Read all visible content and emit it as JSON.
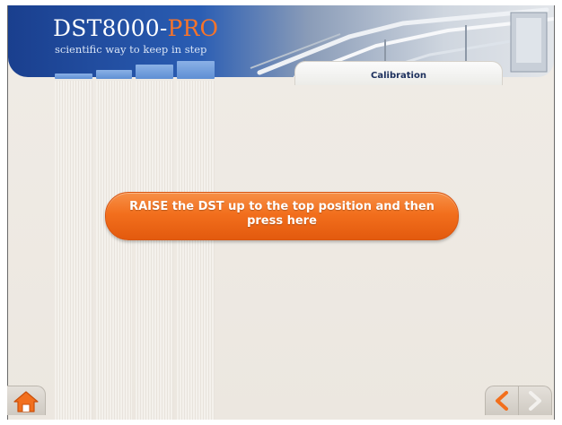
{
  "header": {
    "logo_main": "DST8000-",
    "logo_accent": "PRO",
    "tagline": "scientific way to keep in step",
    "tab_title": "Calibration",
    "brand_color": "#1a3f8e",
    "accent_color": "#f7742a"
  },
  "main": {
    "action_button_label": "RAISE the DST up to the top position and then press here",
    "action_button_color": "#f26f1d"
  },
  "footer": {
    "home_icon": "home-icon",
    "back_icon": "chevron-left-icon",
    "next_icon": "chevron-right-icon"
  }
}
